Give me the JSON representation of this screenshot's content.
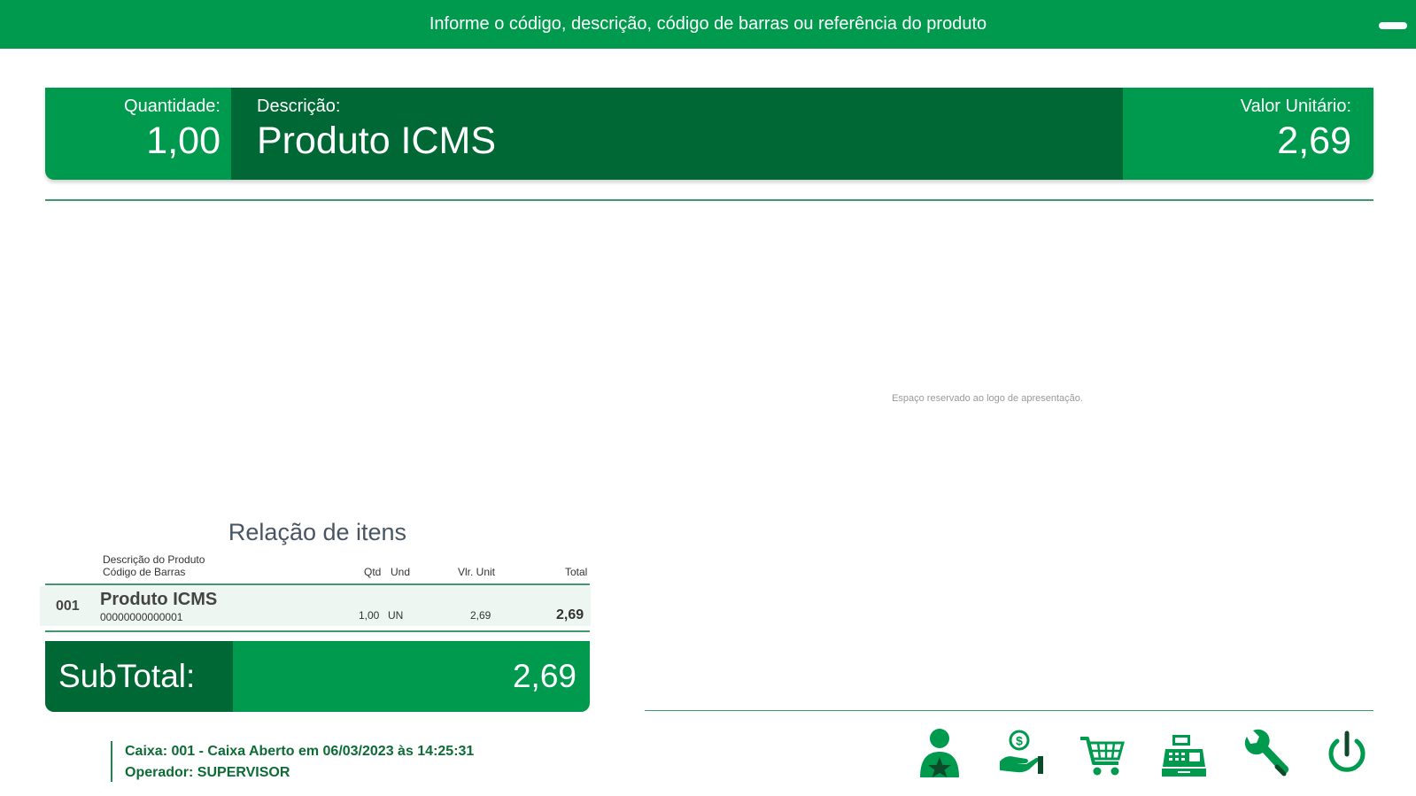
{
  "topbar": {
    "prompt": "Informe o código, descrição, código de barras ou referência do produto"
  },
  "product_bar": {
    "quantity_label": "Quantidade:",
    "quantity_value": "1,00",
    "description_label": "Descrição:",
    "description_value": "Produto ICMS",
    "unit_value_label": "Valor Unitário:",
    "unit_value_value": "2,69"
  },
  "logo_placeholder": "Espaço reservado ao logo de apresentação.",
  "items": {
    "title": "Relação de itens",
    "headers": {
      "description": "Descrição do Produto",
      "barcode": "Código de Barras",
      "qty": "Qtd",
      "unit": "Und",
      "unit_price": "Vlr. Unit",
      "total": "Total"
    },
    "rows": [
      {
        "index": "001",
        "description": "Produto ICMS",
        "barcode": "00000000000001",
        "qty": "1,00",
        "unit": "UN",
        "unit_price": "2,69",
        "total": "2,69"
      }
    ]
  },
  "subtotal": {
    "label": "SubTotal:",
    "value": "2,69"
  },
  "status": {
    "caixa_label": "Caixa:",
    "caixa_value": "001 - Caixa Aberto em 06/03/2023 às 14:25:31",
    "operator_label": "Operador:",
    "operator_value": "SUPERVISOR"
  },
  "toolbar": {
    "icons": [
      "customer-icon",
      "payment-icon",
      "cart-icon",
      "cash-register-icon",
      "wrench-icon",
      "power-icon"
    ]
  },
  "colors": {
    "primary": "#009a4e",
    "dark": "#006834",
    "text_dark_green": "#0d6b35"
  }
}
